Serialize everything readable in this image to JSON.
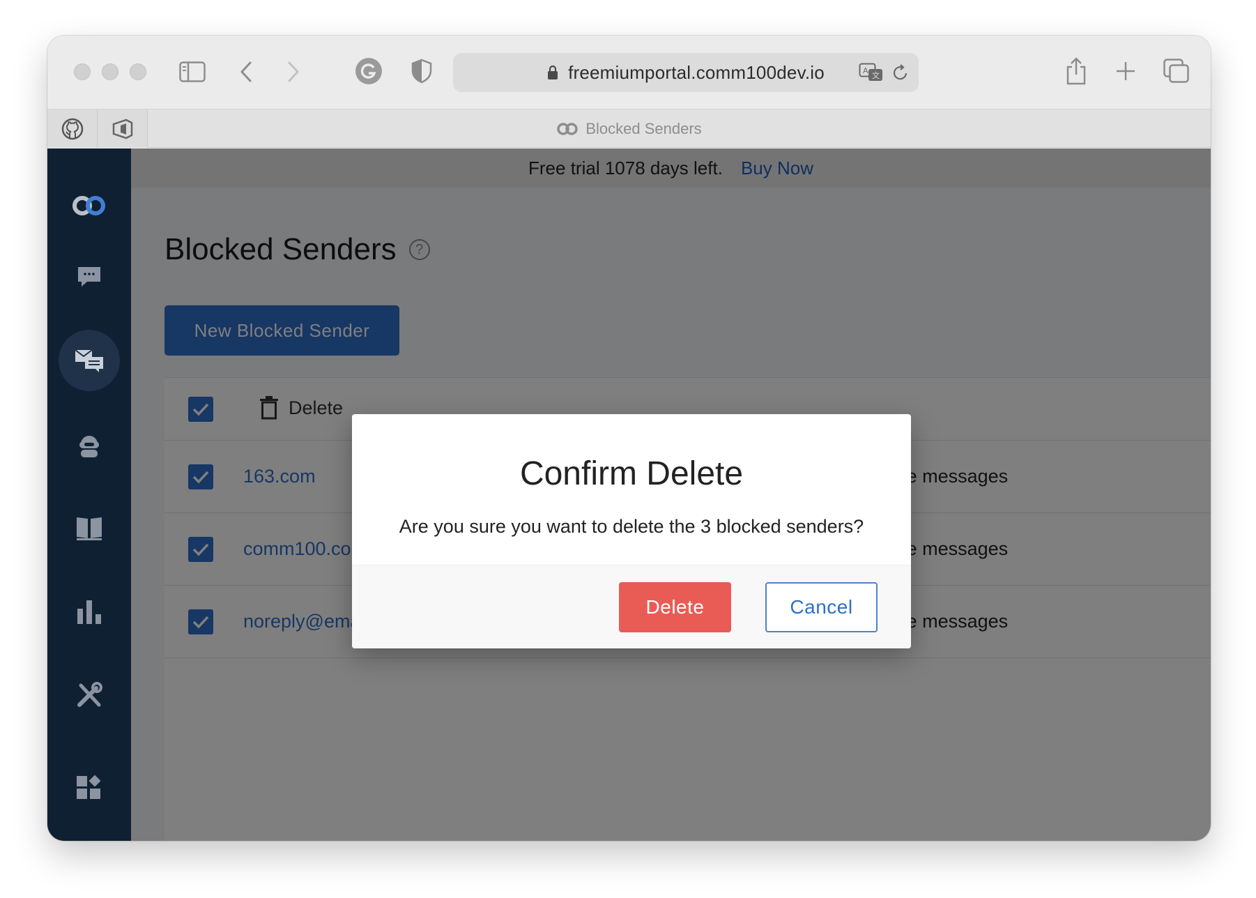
{
  "browser": {
    "url": "freemiumportal.comm100dev.io",
    "tab_title": "Blocked Senders"
  },
  "banner": {
    "trial_text": "Free trial 1078 days left.",
    "buy_label": "Buy Now"
  },
  "page": {
    "title": "Blocked Senders",
    "help_symbol": "?",
    "new_button_label": "New Blocked Sender"
  },
  "table": {
    "toolbar_delete_label": "Delete",
    "rows": [
      {
        "sender": "163.com",
        "action": "Reject all future messages",
        "checked": true
      },
      {
        "sender": "comm100.com",
        "action": "Reject all future messages",
        "checked": true
      },
      {
        "sender": "noreply@email.teams.microsoft.com",
        "action": "Reject all future messages",
        "checked": true
      }
    ]
  },
  "modal": {
    "title": "Confirm Delete",
    "message": "Are you sure you want to delete the 3 blocked senders?",
    "delete_label": "Delete",
    "cancel_label": "Cancel"
  },
  "colors": {
    "accent": "#2f6ec9",
    "danger": "#e85c55",
    "sidebar": "#0f2033"
  }
}
